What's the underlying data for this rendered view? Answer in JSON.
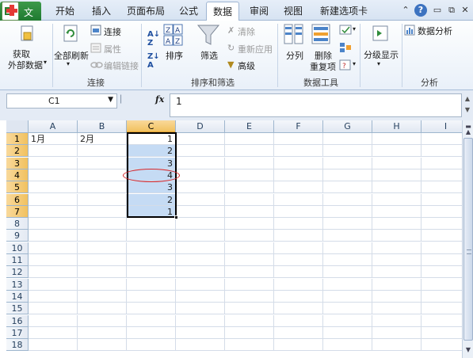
{
  "tabs": {
    "file": "文件",
    "items": [
      "开始",
      "插入",
      "页面布局",
      "公式",
      "数据",
      "审阅",
      "视图",
      "新建选项卡"
    ],
    "active_index": 4
  },
  "window_controls": [
    "chevron-up-icon",
    "help-icon",
    "restore-icon",
    "close-icon"
  ],
  "ribbon": {
    "connections": {
      "get_external_data_line1": "获取",
      "get_external_data_line2": "外部数据",
      "refresh_all": "全部刷新",
      "connections": "连接",
      "properties": "属性",
      "edit_links": "编辑链接",
      "group_label": "连接"
    },
    "sort_filter": {
      "sort": "排序",
      "filter": "筛选",
      "clear": "清除",
      "reapply": "重新应用",
      "advanced": "高级",
      "group_label": "排序和筛选"
    },
    "data_tools": {
      "text_to_columns": "分列",
      "remove_duplicates_line1": "删除",
      "remove_duplicates_line2": "重复项",
      "group_label": "数据工具"
    },
    "outline": {
      "group": "分级显示"
    },
    "analysis": {
      "data_analysis": "数据分析",
      "group_label": "分析"
    }
  },
  "formula_bar": {
    "name_box": "C1",
    "fx": "fx",
    "formula": "1"
  },
  "sheet": {
    "columns": [
      "A",
      "B",
      "C",
      "D",
      "E",
      "F",
      "G",
      "H",
      "I"
    ],
    "selected_column": "C",
    "rows": [
      "1",
      "2",
      "3",
      "4",
      "5",
      "6",
      "7",
      "8",
      "9",
      "10",
      "11",
      "12",
      "13",
      "14",
      "15",
      "16",
      "17",
      "18"
    ],
    "selected_rows": [
      "1",
      "2",
      "3",
      "4",
      "5",
      "6",
      "7"
    ],
    "cells": {
      "A1": "1月",
      "B1": "2月",
      "C": [
        "1",
        "2",
        "3",
        "4",
        "3",
        "2",
        "1"
      ]
    },
    "active_cell": "C1",
    "circled_cell": "C4"
  },
  "colors": {
    "selection_fill": "#c5dbf4",
    "header_highlight": "#f1c15f",
    "annotation_circle": "#d4262b",
    "file_tab": "#1f7a30"
  }
}
